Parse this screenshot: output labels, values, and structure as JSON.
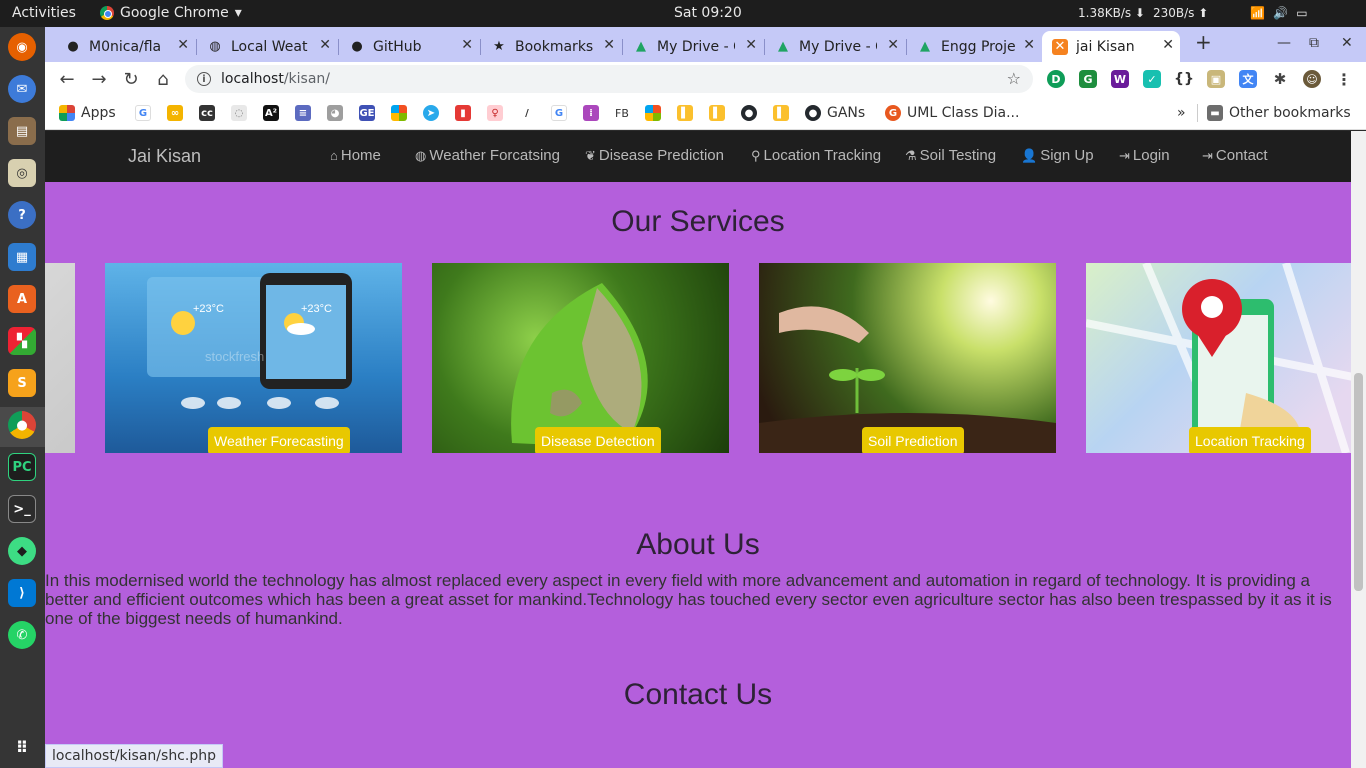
{
  "system_bar": {
    "activities": "Activities",
    "app_name": "Google Chrome",
    "clock": "Sat 09:20",
    "net_down": "1.38KB/s ⬇",
    "net_up": "230B/s ⬆"
  },
  "tabs": [
    {
      "title": "M0nica/fla",
      "icon": "github-icon"
    },
    {
      "title": "Local Weat",
      "icon": "globe-icon"
    },
    {
      "title": "GitHub",
      "icon": "github-icon"
    },
    {
      "title": "Bookmarks",
      "icon": "star-icon"
    },
    {
      "title": "My Drive - G",
      "icon": "drive-icon"
    },
    {
      "title": "My Drive - G",
      "icon": "drive-icon"
    },
    {
      "title": "Engg Proje",
      "icon": "drive-icon"
    },
    {
      "title": "jai Kisan",
      "icon": "xampp-icon",
      "active": true
    }
  ],
  "address_bar": {
    "host": "localhost",
    "path": "/kisan/"
  },
  "bookmarks": {
    "apps": "Apps",
    "gans": "GANs",
    "uml": "UML Class Dia...",
    "fb": "FB",
    "more": "»",
    "other": "Other bookmarks"
  },
  "site": {
    "brand": "Jai Kisan",
    "nav": [
      {
        "label": "Home",
        "icon": "home-icon"
      },
      {
        "label": "Weather Forcatsing",
        "icon": "globe-icon"
      },
      {
        "label": "Disease Prediction",
        "icon": "leaf-icon"
      },
      {
        "label": "Location Tracking",
        "icon": "map-marker-icon"
      },
      {
        "label": "Soil Testing",
        "icon": "flask-icon"
      },
      {
        "label": "Sign Up",
        "icon": "user-icon"
      },
      {
        "label": "Login",
        "icon": "login-icon"
      },
      {
        "label": "Contact",
        "icon": "login-icon"
      }
    ],
    "services_title": "Our Services",
    "services": [
      {
        "label": "Weather Forecasting"
      },
      {
        "label": "Disease Detection"
      },
      {
        "label": "Soil Prediction"
      },
      {
        "label": "Location Tracking"
      }
    ],
    "weather_card": {
      "temp": "+23°C",
      "watermark": "stockfresh"
    },
    "about_title": "About Us",
    "about_text": "In this modernised world the technology has almost replaced every aspect in every field with more advancement and automation in regard of technology. It is providing a better and efficient outcomes which has been a great asset for mankind.Technology has touched every sector even agriculture sector has also been trespassed by it as it is one of the biggest needs of humankind.",
    "contact_title": "Contact Us"
  },
  "status_url": "localhost/kisan/shc.php"
}
